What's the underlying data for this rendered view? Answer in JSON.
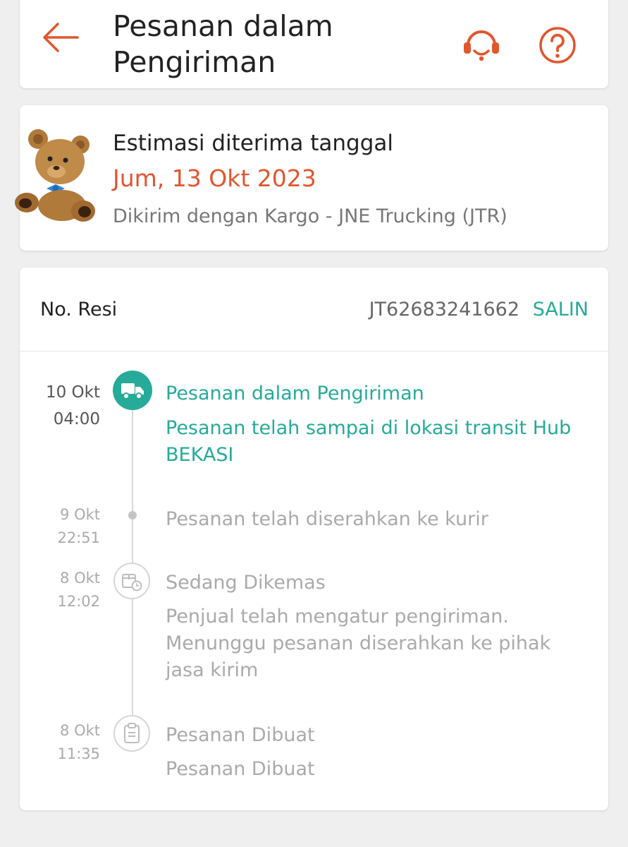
{
  "header": {
    "title": "Pesanan dalam Pengiriman",
    "back_icon": "arrow-left-icon",
    "support_icon": "headset-icon",
    "help_icon": "question-circle-icon"
  },
  "estimate": {
    "title": "Estimasi diterima tanggal",
    "date": "Jum, 13 Okt 2023",
    "courier": "Dikirim dengan Kargo - JNE Trucking (JTR)",
    "illustration": "teddy-bear-icon"
  },
  "tracking": {
    "resi_label": "No. Resi",
    "resi_number": "JT62683241662",
    "copy_label": "SALIN",
    "events": [
      {
        "time": "10 Okt\n04:00",
        "title": "Pesanan dalam Pengiriman",
        "description": "Pesanan telah sampai di lokasi transit Hub BEKASI",
        "icon": "truck-icon"
      },
      {
        "time": "9 Okt\n22:51",
        "title": "Pesanan telah diserahkan ke kurir",
        "icon": "dot"
      },
      {
        "time": "8 Okt\n12:02",
        "title": "Sedang Dikemas",
        "description": "Penjual telah mengatur pengiriman. Menunggu pesanan diserahkan ke pihak jasa kirim",
        "icon": "package-clock-icon"
      },
      {
        "time": "8 Okt\n11:35",
        "title": "Pesanan Dibuat",
        "description": "Pesanan Dibuat",
        "icon": "clipboard-icon"
      }
    ]
  },
  "colors": {
    "accent": "#e0562e",
    "teal": "#26aa99",
    "muted": "#aaaaaa",
    "background": "#efefef"
  }
}
